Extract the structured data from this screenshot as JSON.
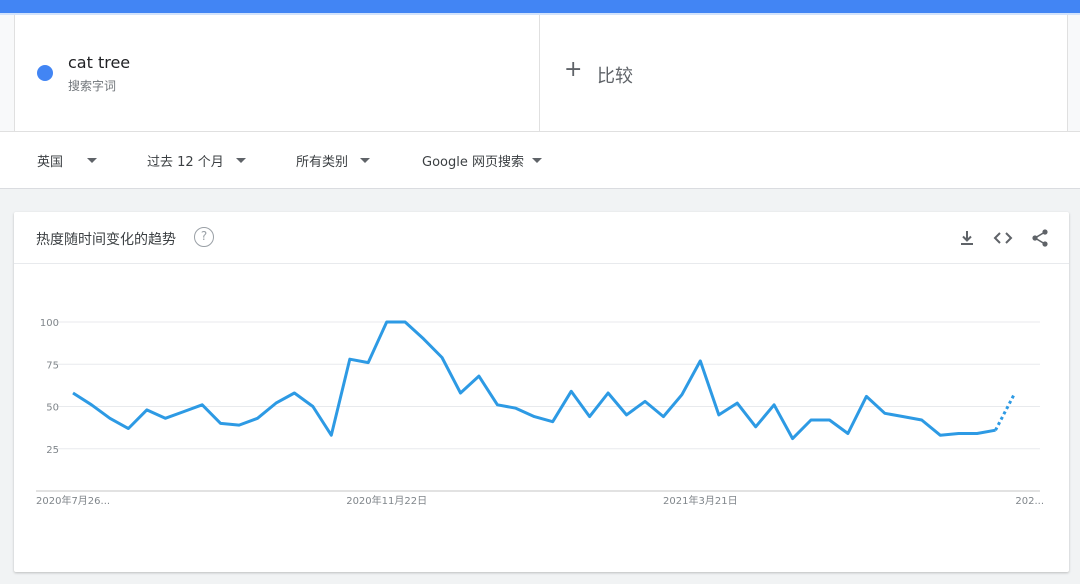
{
  "colors": {
    "accent": "#4285f4",
    "line": "#2d9ae4"
  },
  "term": {
    "name": "cat tree",
    "subtitle": "搜索字词"
  },
  "compare": {
    "label": "比较",
    "icon": "plus-icon"
  },
  "filters": {
    "region": "英国",
    "time": "过去 12 个月",
    "category": "所有类别",
    "property": "Google 网页搜索"
  },
  "panel": {
    "title": "热度随时间变化的趋势",
    "help_symbol": "?"
  },
  "chart_data": {
    "type": "line",
    "title": "热度随时间变化的趋势",
    "xlabel": "",
    "ylabel": "",
    "ylim": [
      0,
      100
    ],
    "yticks": [
      25,
      50,
      75,
      100
    ],
    "x_tick_labels": [
      "2020年7月26...",
      "2020年11月22日",
      "2021年3月21日",
      "202..."
    ],
    "x_tick_index": [
      0,
      17,
      34,
      51
    ],
    "grid": true,
    "series": [
      {
        "values": [
          58,
          51,
          43,
          37,
          48,
          43,
          47,
          51,
          40,
          39,
          43,
          52,
          58,
          50,
          33,
          78,
          76,
          100,
          100,
          90,
          79,
          58,
          68,
          51,
          49,
          44,
          41,
          59,
          44,
          58,
          45,
          53,
          44,
          57,
          77,
          45,
          52,
          38,
          51,
          31,
          42,
          42,
          34,
          56,
          46,
          44,
          42,
          33,
          34,
          34,
          36,
          57
        ],
        "partial_from_index": 50
      }
    ]
  }
}
